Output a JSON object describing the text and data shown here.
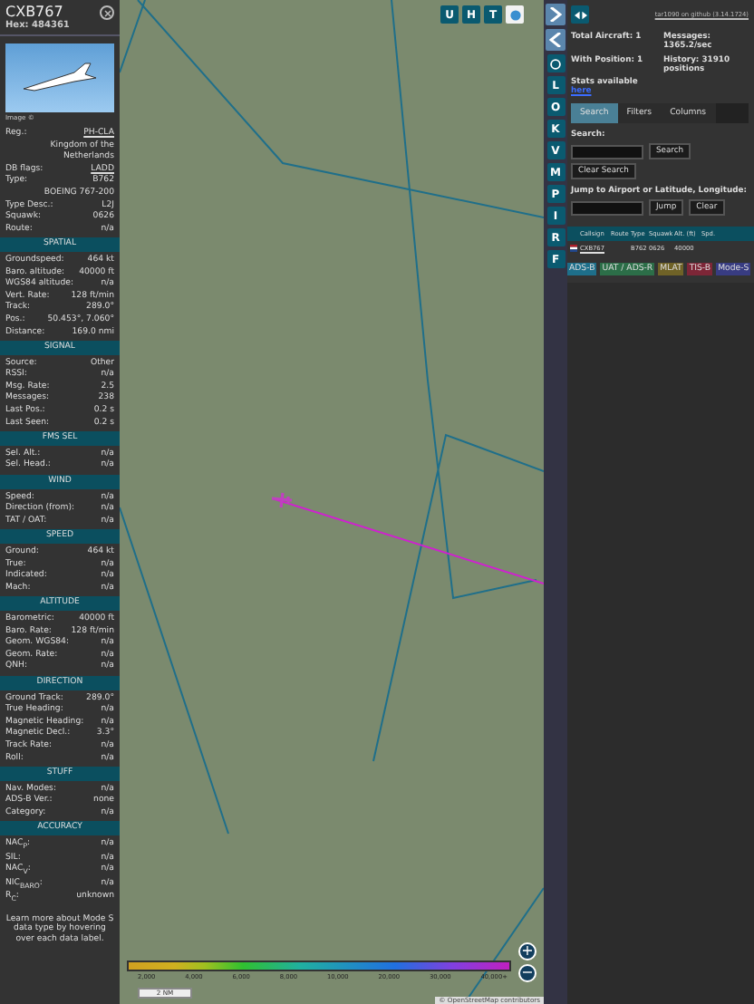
{
  "aircraft": {
    "callsign": "CXB767",
    "hex": "Hex: 484361",
    "image_credit": "Image ©"
  },
  "sections": [
    {
      "rows": [
        {
          "label": "Reg.:",
          "value": "PH-CLA",
          "link": true
        },
        {
          "value": "Kingdom of the Netherlands",
          "link": false
        },
        {
          "label": "DB flags:",
          "value": "LADD",
          "link": true
        },
        {
          "label": "Type:",
          "value": "B762",
          "link": false
        },
        {
          "value": "BOEING 767-200",
          "link": false
        },
        {
          "label": "Type Desc.:",
          "value": "L2J",
          "link": false
        },
        {
          "label": "Squawk:",
          "value": "0626",
          "link": false
        },
        {
          "label": "Route:",
          "value": "n/a",
          "link": false
        }
      ]
    },
    {
      "title": "SPATIAL",
      "rows": [
        {
          "label": "Groundspeed:",
          "value": "464 kt"
        },
        {
          "label": "Baro. altitude:",
          "value": "40000 ft"
        },
        {
          "label": "WGS84 altitude:",
          "value": "n/a"
        },
        {
          "label": "Vert. Rate:",
          "value": "128 ft/min"
        },
        {
          "label": "Track:",
          "value": "289.0°"
        },
        {
          "label": "Pos.:",
          "value": "50.453°, 7.060°"
        },
        {
          "label": "Distance:",
          "value": "169.0 nmi"
        }
      ]
    },
    {
      "title": "SIGNAL",
      "rows": [
        {
          "label": "Source:",
          "value": "Other"
        },
        {
          "label": "RSSI:",
          "value": "n/a"
        },
        {
          "label": "Msg. Rate:",
          "value": "2.5"
        },
        {
          "label": "Messages:",
          "value": "238"
        },
        {
          "label": "Last Pos.:",
          "value": "0.2 s"
        },
        {
          "label": "Last Seen:",
          "value": "0.2 s"
        }
      ]
    },
    {
      "title": "FMS SEL",
      "rows": [
        {
          "label": "Sel. Alt.:",
          "value": "n/a"
        },
        {
          "label": "Sel. Head.:",
          "value": "n/a"
        }
      ]
    },
    {
      "title": "WIND",
      "rows": [
        {
          "label": "Speed:",
          "value": "n/a"
        },
        {
          "label": "Direction (from):",
          "value": "n/a"
        },
        {
          "label": "TAT / OAT:",
          "value": "n/a"
        }
      ]
    },
    {
      "title": "SPEED",
      "rows": [
        {
          "label": "Ground:",
          "value": "464 kt"
        },
        {
          "label": "True:",
          "value": "n/a"
        },
        {
          "label": "Indicated:",
          "value": "n/a"
        },
        {
          "label": "Mach:",
          "value": "n/a"
        }
      ]
    },
    {
      "title": "ALTITUDE",
      "rows": [
        {
          "label": "Barometric:",
          "value": "40000 ft"
        },
        {
          "label": "Baro. Rate:",
          "value": "128 ft/min"
        },
        {
          "label": "Geom. WGS84:",
          "value": "n/a"
        },
        {
          "label": "Geom. Rate:",
          "value": "n/a"
        },
        {
          "label": "QNH:",
          "value": "n/a"
        }
      ]
    },
    {
      "title": "DIRECTION",
      "rows": [
        {
          "label": "Ground Track:",
          "value": "289.0°"
        },
        {
          "label": "True Heading:",
          "value": "n/a"
        },
        {
          "label": "Magnetic Heading:",
          "value": "n/a"
        },
        {
          "label": "Magnetic Decl.:",
          "value": "3.3°"
        },
        {
          "label": "Track Rate:",
          "value": "n/a"
        },
        {
          "label": "Roll:",
          "value": "n/a"
        }
      ]
    },
    {
      "title": "STUFF",
      "rows": [
        {
          "label": "Nav. Modes:",
          "value": "n/a"
        },
        {
          "label": "ADS-B Ver.:",
          "value": "none"
        },
        {
          "label": "Category:",
          "value": "n/a"
        }
      ]
    },
    {
      "title": "ACCURACY",
      "rows": [
        {
          "label": "NAC$_{P}$:",
          "value": "n/a"
        },
        {
          "label": "SIL:",
          "value": "n/a"
        },
        {
          "label": "NAC$_{V}$:",
          "value": "n/a"
        },
        {
          "label": "NIC$_{BARO}$:",
          "value": "n/a"
        },
        {
          "label": "R$_{C}$:",
          "value": "unknown"
        }
      ]
    }
  ],
  "footer": "Learn more about Mode S data type by hovering over each data label.",
  "map": {
    "top_buttons": [
      "U",
      "H",
      "T"
    ],
    "side_buttons": [
      "L",
      "O",
      "K",
      "V",
      "M",
      "P",
      "I",
      "R",
      "F"
    ],
    "zoom_in": "+",
    "zoom_out": "−",
    "scale": "2 NM",
    "attribution": "© OpenStreetMap contributors",
    "altitude_legend": [
      "2,000",
      "4,000",
      "6,000",
      "8,000",
      "10,000",
      "20,000",
      "30,000",
      "40,000+"
    ]
  },
  "panel": {
    "version_link": "tar1090 on github (3.14.1724)",
    "stats": [
      {
        "label": "Total Aircraft: 1"
      },
      {
        "label": "Messages: 1365.2/sec"
      },
      {
        "label": "With Position: 1"
      },
      {
        "label": "History: 31910 positions"
      }
    ],
    "stats_text": "Stats available",
    "stats_link": "here",
    "tabs": [
      {
        "label": "Search",
        "selected": true
      },
      {
        "label": "Filters",
        "selected": false
      },
      {
        "label": "Columns",
        "selected": false
      }
    ],
    "search_label": "Search:",
    "search_button": "Search",
    "clear_search_button": "Clear Search",
    "jump_label": "Jump to Airport or Latitude, Longitude:",
    "jump_button": "Jump",
    "clear_button": "Clear",
    "table": {
      "columns": [
        "Callsign",
        "Route",
        "Type",
        "Squawk",
        "Alt. (ft)",
        "Spd."
      ],
      "rows": [
        {
          "callsign": "CXB767",
          "type": "B762",
          "squawk": "0626",
          "altitude": "40000"
        }
      ]
    },
    "legend": [
      {
        "label": "ADS-B",
        "color": "#1e6f8a"
      },
      {
        "label": "UAT / ADS-R",
        "color": "#2c6e48"
      },
      {
        "label": "MLAT",
        "color": "#6f6227"
      },
      {
        "label": "TIS-B",
        "color": "#7d2637"
      },
      {
        "label": "Mode-S",
        "color": "#383c82"
      }
    ]
  }
}
